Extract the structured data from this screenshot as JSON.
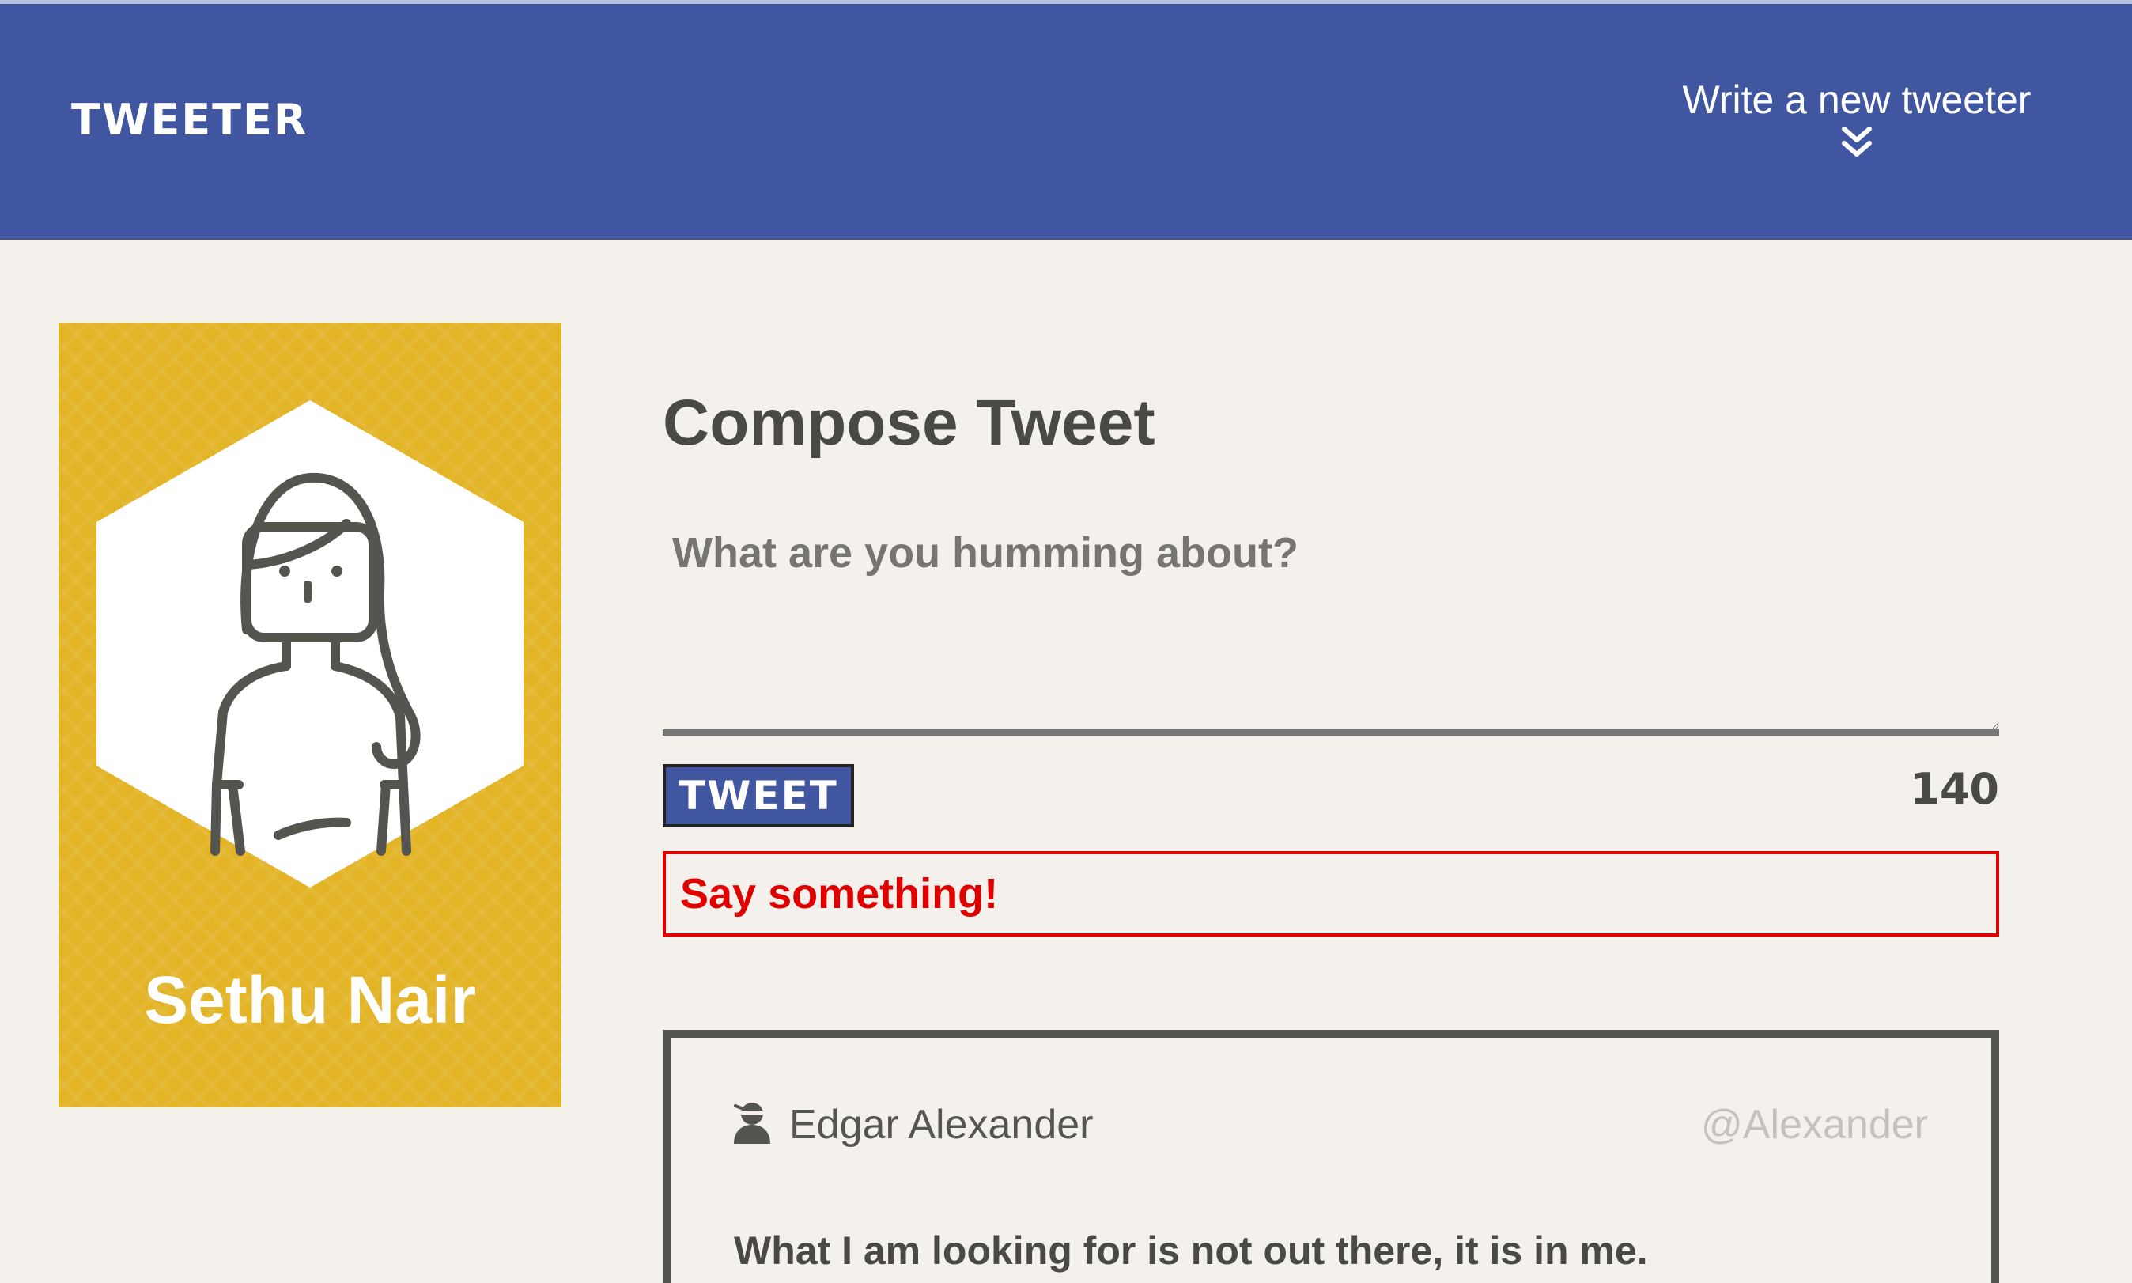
{
  "header": {
    "brand": "TWEETER",
    "compose_toggle_label": "Write a new tweeter",
    "compose_toggle_icon": "double-chevron-down-icon"
  },
  "profile": {
    "name": "Sethu Nair",
    "avatar_icon": "woman-avatar-icon",
    "card_color": "#e2b426"
  },
  "compose": {
    "title": "Compose Tweet",
    "placeholder": "What are you humming about?",
    "value": "",
    "button_label": "TWEET",
    "counter": "140",
    "error": "Say something!"
  },
  "tweets": [
    {
      "name": "Edgar Alexander",
      "handle": "@Alexander",
      "avatar_icon": "ninja-avatar-icon",
      "text": "What I am looking for is not out there, it is in me."
    }
  ],
  "colors": {
    "nav": "#4056a1",
    "background": "#f4f1ed",
    "error": "#e00000",
    "text": "#4a4a44"
  }
}
